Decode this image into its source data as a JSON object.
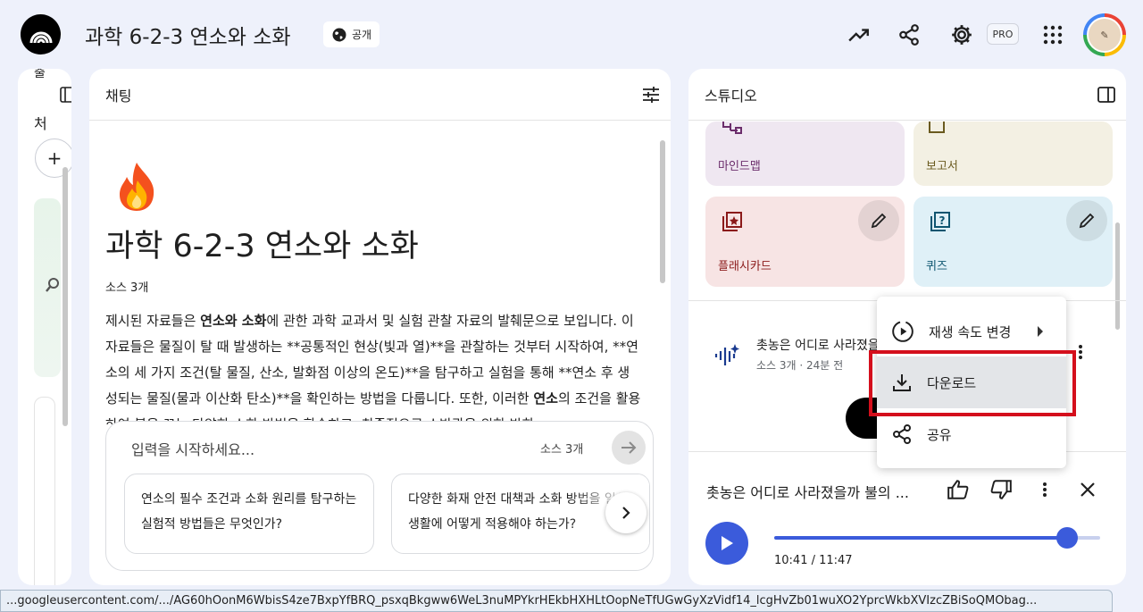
{
  "header": {
    "title": "과학 6-2-3 연소와 소화",
    "public_label": "공개",
    "pro_label": "PRO"
  },
  "left_panel": {
    "label_top": "출",
    "label_sources": "처",
    "add_symbol": "+"
  },
  "chat": {
    "header": "채팅",
    "emoji": "🔥",
    "notebook_title": "과학 6-2-3 연소와 소화",
    "source_count": "소스 3개",
    "summary_parts": [
      "제시된 자료들은 ",
      "연소와 소화",
      "에 관한 과학 교과서 및 실험 관찰 자료의 발췌문으로 보입니다. 이 자료들은 물질이 탈 때 발생하는 **공통적인 현상(빛과 열)**을 관찰하는 것부터 시작하여, **연소의 세 가지 조건(탈 물질, 산소, 발화점 이상의 온도)**을 탐구하고 실험을 통해 **연소 후 생성되는 물질(물과 이산화 탄소)**을 확인하는 방법을 다룹니다. 또한, 이러한 ",
      "연소",
      "의 조건을 활용하여 불을 끄는 다양한 소화 방법을 학습하고, 최종적으로 소방관을 위한 방화"
    ],
    "input_placeholder": "입력을 시작하세요...",
    "input_source_count": "소스 3개",
    "suggestions": [
      "연소의 필수 조건과 소화 원리를 탐구하는 실험적 방법들은 무엇인가?",
      "다양한 화재 안전 대책과 소화 방법을 일상생활에 어떻게 적용해야 하는가?"
    ]
  },
  "studio": {
    "header": "스튜디오",
    "tiles": [
      {
        "label": "마인드맵",
        "color": "#efe7f1"
      },
      {
        "label": "보고서",
        "color": "#f3f0e3"
      },
      {
        "label": "플래시카드",
        "color": "#f7e4e4"
      },
      {
        "label": "퀴즈",
        "color": "#dff0f7"
      }
    ],
    "audio_item": {
      "title": "촛농은 어디로 사라졌을까 불의",
      "meta": "소스 3개 · 24분 전"
    },
    "player": {
      "title": "촛농은 어디로 사라졌을까 불의 ...",
      "time": "10:41 / 11:47",
      "progress": 0.93
    }
  },
  "menu": {
    "items": [
      {
        "label": "재생 속도 변경",
        "icon": "playback-speed-icon"
      },
      {
        "label": "다운로드",
        "icon": "download-icon"
      },
      {
        "label": "공유",
        "icon": "share-icon"
      }
    ]
  },
  "statusbar": {
    "url": "...googleusercontent.com/.../AG60hOonM6WbisS4ze7BxpYfBRQ_psxqBkgww6WeL3nuMPYkrHEkbHXHLtOopNeTfUGwGyXzVidf14_lcgHvZb01wuXO2YprcWkbXVIzcZBiSoQMObag..."
  },
  "colors": {
    "accent": "#3b5bdb",
    "highlight_frame": "#d40f1c",
    "background": "#eef1fb"
  }
}
